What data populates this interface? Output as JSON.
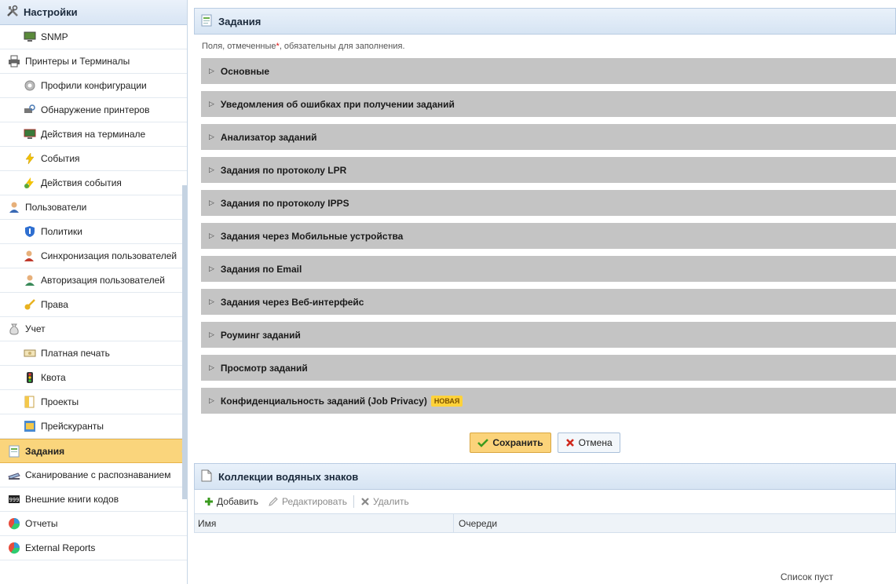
{
  "sidebar": {
    "title": "Настройки",
    "items": [
      {
        "label": "SNMP",
        "level": 1,
        "icon": "monitor-icon"
      },
      {
        "label": "Принтеры и Терминалы",
        "level": 0,
        "icon": "printer-icon"
      },
      {
        "label": "Профили конфигурации",
        "level": 1,
        "icon": "gear-icon"
      },
      {
        "label": "Обнаружение принтеров",
        "level": 1,
        "icon": "printer-search-icon"
      },
      {
        "label": "Действия на терминале",
        "level": 1,
        "icon": "terminal-icon"
      },
      {
        "label": "События",
        "level": 1,
        "icon": "lightning-icon"
      },
      {
        "label": "Действия события",
        "level": 1,
        "icon": "lightning-action-icon"
      },
      {
        "label": "Пользователи",
        "level": 0,
        "icon": "user-icon"
      },
      {
        "label": "Политики",
        "level": 1,
        "icon": "shield-icon"
      },
      {
        "label": "Синхронизация пользователей",
        "level": 1,
        "icon": "user-sync-icon"
      },
      {
        "label": "Авторизация пользователей",
        "level": 1,
        "icon": "user-auth-icon"
      },
      {
        "label": "Права",
        "level": 1,
        "icon": "key-icon"
      },
      {
        "label": "Учет",
        "level": 0,
        "icon": "money-bag-icon"
      },
      {
        "label": "Платная печать",
        "level": 1,
        "icon": "banknote-icon"
      },
      {
        "label": "Квота",
        "level": 1,
        "icon": "traffic-light-icon"
      },
      {
        "label": "Проекты",
        "level": 1,
        "icon": "folder-icon"
      },
      {
        "label": "Прейскуранты",
        "level": 1,
        "icon": "price-list-icon"
      },
      {
        "label": "Задания",
        "level": 0,
        "icon": "document-icon",
        "active": true
      },
      {
        "label": "Сканирование с распознаванием",
        "level": 0,
        "icon": "scanner-icon"
      },
      {
        "label": "Внешние книги кодов",
        "level": 0,
        "icon": "codebook-icon"
      },
      {
        "label": "Отчеты",
        "level": 0,
        "icon": "pie-chart-icon"
      },
      {
        "label": "External Reports",
        "level": 0,
        "icon": "pie-chart-icon"
      }
    ]
  },
  "main": {
    "title": "Задания",
    "required_note_before": "Поля, отмеченные ",
    "required_note_star": "*",
    "required_note_after": ", обязательны для заполнения.",
    "sections": [
      {
        "label": "Основные"
      },
      {
        "label": "Уведомления об ошибках при получении заданий"
      },
      {
        "label": "Анализатор заданий"
      },
      {
        "label": "Задания по протоколу LPR"
      },
      {
        "label": "Задания по протоколу IPPS"
      },
      {
        "label": "Задания через Мобильные устройства"
      },
      {
        "label": "Задания по Email"
      },
      {
        "label": "Задания через Веб-интерфейс"
      },
      {
        "label": "Роуминг заданий"
      },
      {
        "label": "Просмотр заданий"
      },
      {
        "label": "Конфиденциальность заданий (Job Privacy)",
        "badge": "НОВАЯ"
      }
    ],
    "save_label": "Сохранить",
    "cancel_label": "Отмена"
  },
  "watermarks": {
    "title": "Коллекции водяных знаков",
    "toolbar": {
      "add": "Добавить",
      "edit": "Редактировать",
      "delete": "Удалить"
    },
    "columns": {
      "name": "Имя",
      "queues": "Очереди"
    },
    "empty_text": "Список пуст"
  },
  "colors": {
    "active_item": "#fad57c",
    "section_bg": "#c4c4c4",
    "header_bg": "#d6e4f3",
    "badge": "#ffd23a"
  }
}
